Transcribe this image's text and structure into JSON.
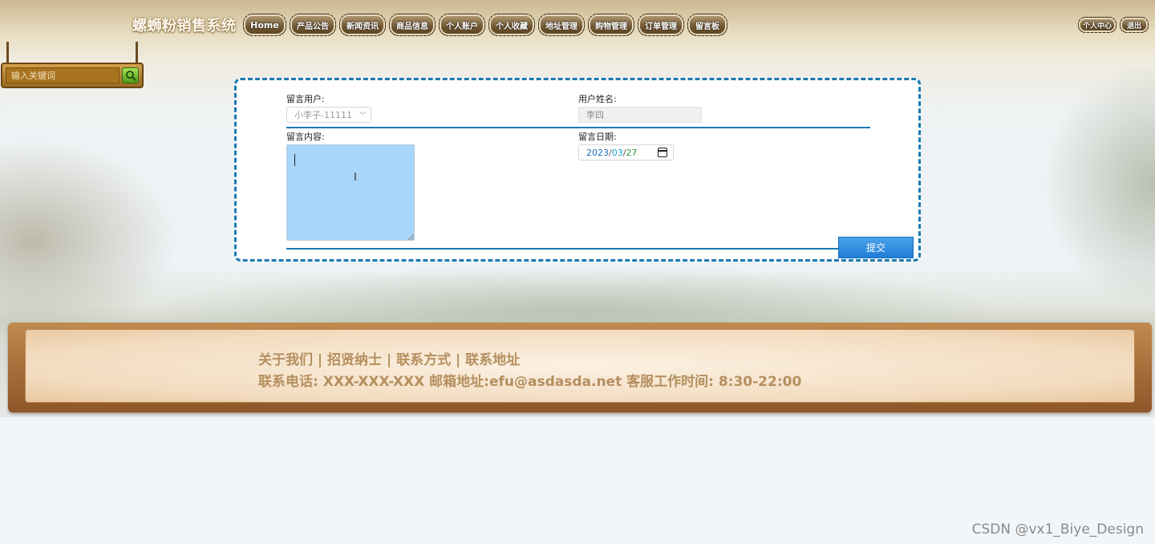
{
  "header": {
    "site_title": "螺蛳粉销售系统",
    "nav": [
      "Home",
      "产品公告",
      "新闻资讯",
      "商品信息",
      "个人账户",
      "个人收藏",
      "地址管理",
      "购物管理",
      "订单管理",
      "留言板"
    ],
    "user_nav": [
      "个人中心",
      "退出"
    ]
  },
  "search": {
    "placeholder": "输入关键词"
  },
  "form": {
    "user_label": "留言用户:",
    "user_value": "小李子-11111",
    "name_label": "用户姓名:",
    "name_value": "李四",
    "content_label": "留言内容:",
    "content_value": "",
    "date_label": "留言日期:",
    "date_year": "2023",
    "date_month": "03",
    "date_day": "27",
    "date_sep": "/",
    "submit_label": "提交"
  },
  "footer": {
    "links_line": "关于我们 | 招贤纳士 | 联系方式 | 联系地址",
    "contact_line": "联系电话: XXX-XXX-XXX 邮箱地址:efu@asdasda.net 客服工作时间: 8:30-22:00"
  },
  "watermark": "CSDN @vx1_Biye_Design",
  "colors": {
    "accent": "#1a7ab2",
    "textarea_bg": "#a8d6fb",
    "button": "#1f7fd6",
    "footer_text": "#b58f5f"
  }
}
